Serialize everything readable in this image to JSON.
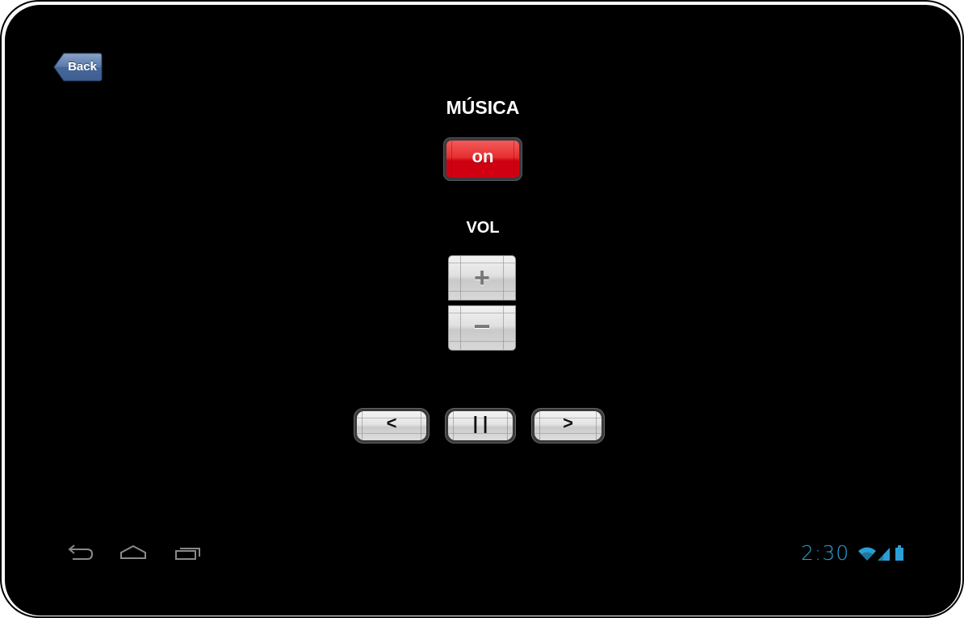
{
  "header": {
    "back_label": "Back"
  },
  "music": {
    "title": "MÚSICA",
    "toggle_label": "on"
  },
  "volume": {
    "title": "VOL",
    "plus_label": "+",
    "minus_label": "−"
  },
  "transport": {
    "prev_label": "<",
    "pause_label": "| |",
    "next_label": ">"
  },
  "navbar": {
    "icons": [
      "back-icon",
      "home-icon",
      "recent-apps-icon"
    ]
  },
  "status_bar": {
    "time": "2:30",
    "icons": [
      "wifi-icon",
      "signal-icon",
      "battery-icon"
    ],
    "accent_color": "#2a9fd6"
  },
  "colors": {
    "toggle_on": "#d30014",
    "back_button": "#4f6f9f"
  }
}
